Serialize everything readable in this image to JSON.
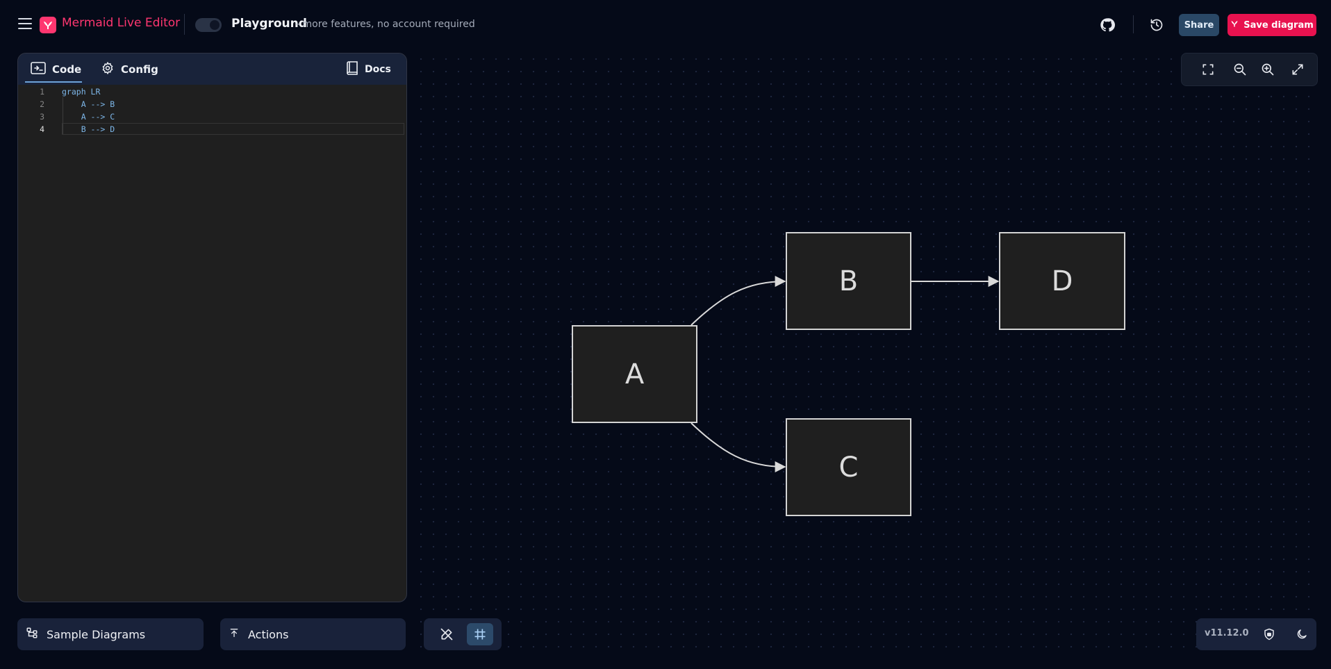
{
  "header": {
    "app_title": "Mermaid Live Editor",
    "playground_label": "Playground",
    "playground_sub": "- more features, no account required",
    "share_label": "Share",
    "save_label": "Save diagram"
  },
  "editor": {
    "tabs": [
      {
        "label": "Code",
        "icon": "code-icon",
        "active": true
      },
      {
        "label": "Config",
        "icon": "gear-icon",
        "active": false
      }
    ],
    "docs_label": "Docs",
    "lines": [
      {
        "num": "1",
        "text": "graph LR"
      },
      {
        "num": "2",
        "text": "    A --> B"
      },
      {
        "num": "3",
        "text": "    A --> C"
      },
      {
        "num": "4",
        "text": "    B --> D"
      }
    ],
    "active_line": 4
  },
  "diagram": {
    "type": "flowchart LR",
    "nodes": [
      {
        "id": "A",
        "label": "A"
      },
      {
        "id": "B",
        "label": "B"
      },
      {
        "id": "C",
        "label": "C"
      },
      {
        "id": "D",
        "label": "D"
      }
    ],
    "edges": [
      {
        "from": "A",
        "to": "B"
      },
      {
        "from": "A",
        "to": "C"
      },
      {
        "from": "B",
        "to": "D"
      }
    ]
  },
  "zoom_toolbar": {
    "buttons": [
      "fit-screen-icon",
      "zoom-out-icon",
      "zoom-in-icon",
      "fullscreen-icon"
    ]
  },
  "bottom": {
    "sample_label": "Sample Diagrams",
    "actions_label": "Actions",
    "version": "v11.12.0"
  },
  "colors": {
    "brand": "#ff3670",
    "save_button": "#e8124f",
    "share_button": "#2a4866",
    "background": "#050a18",
    "code_text": "#7db6e8"
  }
}
